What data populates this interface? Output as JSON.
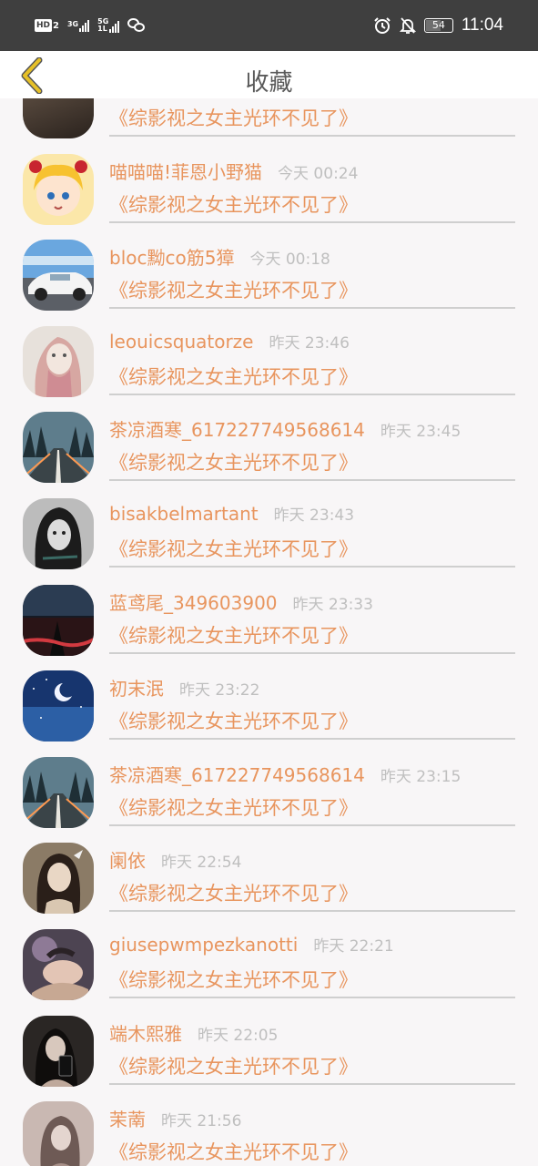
{
  "status_bar": {
    "hd": "HD",
    "sim1_sub": "2",
    "sim1_net": "3G",
    "sim2_net": "5G",
    "sim2_sub": "1L",
    "battery": "54",
    "time": "11:04",
    "icons": [
      "signal-icon",
      "wechat-icon",
      "alarm-icon",
      "notifications-off-icon",
      "battery-icon"
    ]
  },
  "header": {
    "title": "收藏",
    "back_icon": "chevron-left-icon",
    "accent": "#e6c027"
  },
  "colors": {
    "accent_text": "#e8955e",
    "time_text": "#bfbfbf",
    "divider": "#cfcfcf",
    "background": "#f8f6f7"
  },
  "items": [
    {
      "user": "",
      "time": "",
      "book": "《综影视之女主光环不见了》"
    },
    {
      "user": "喵喵喵!菲恩小野猫",
      "time": "今天 00:24",
      "book": "《综影视之女主光环不见了》"
    },
    {
      "user": "bloc黝co筋5獐",
      "time": "今天 00:18",
      "book": "《综影视之女主光环不见了》"
    },
    {
      "user": "leouicsquatorze",
      "time": "昨天 23:46",
      "book": "《综影视之女主光环不见了》"
    },
    {
      "user": "茶凉酒寒_617227749568614",
      "time": "昨天 23:45",
      "book": "《综影视之女主光环不见了》"
    },
    {
      "user": "bisakbelmartant",
      "time": "昨天 23:43",
      "book": "《综影视之女主光环不见了》"
    },
    {
      "user": "蓝鸢尾_349603900",
      "time": "昨天 23:33",
      "book": "《综影视之女主光环不见了》"
    },
    {
      "user": "初末泯",
      "time": "昨天 23:22",
      "book": "《综影视之女主光环不见了》"
    },
    {
      "user": "茶凉酒寒_617227749568614",
      "time": "昨天 23:15",
      "book": "《综影视之女主光环不见了》"
    },
    {
      "user": "阑依",
      "time": "昨天 22:54",
      "book": "《综影视之女主光环不见了》"
    },
    {
      "user": "giusepwmpezkanotti",
      "time": "昨天 22:21",
      "book": "《综影视之女主光环不见了》"
    },
    {
      "user": "端木熙雅",
      "time": "昨天 22:05",
      "book": "《综影视之女主光环不见了》"
    },
    {
      "user": "茉萳",
      "time": "昨天 21:56",
      "book": "《综影视之女主光环不见了》"
    }
  ]
}
